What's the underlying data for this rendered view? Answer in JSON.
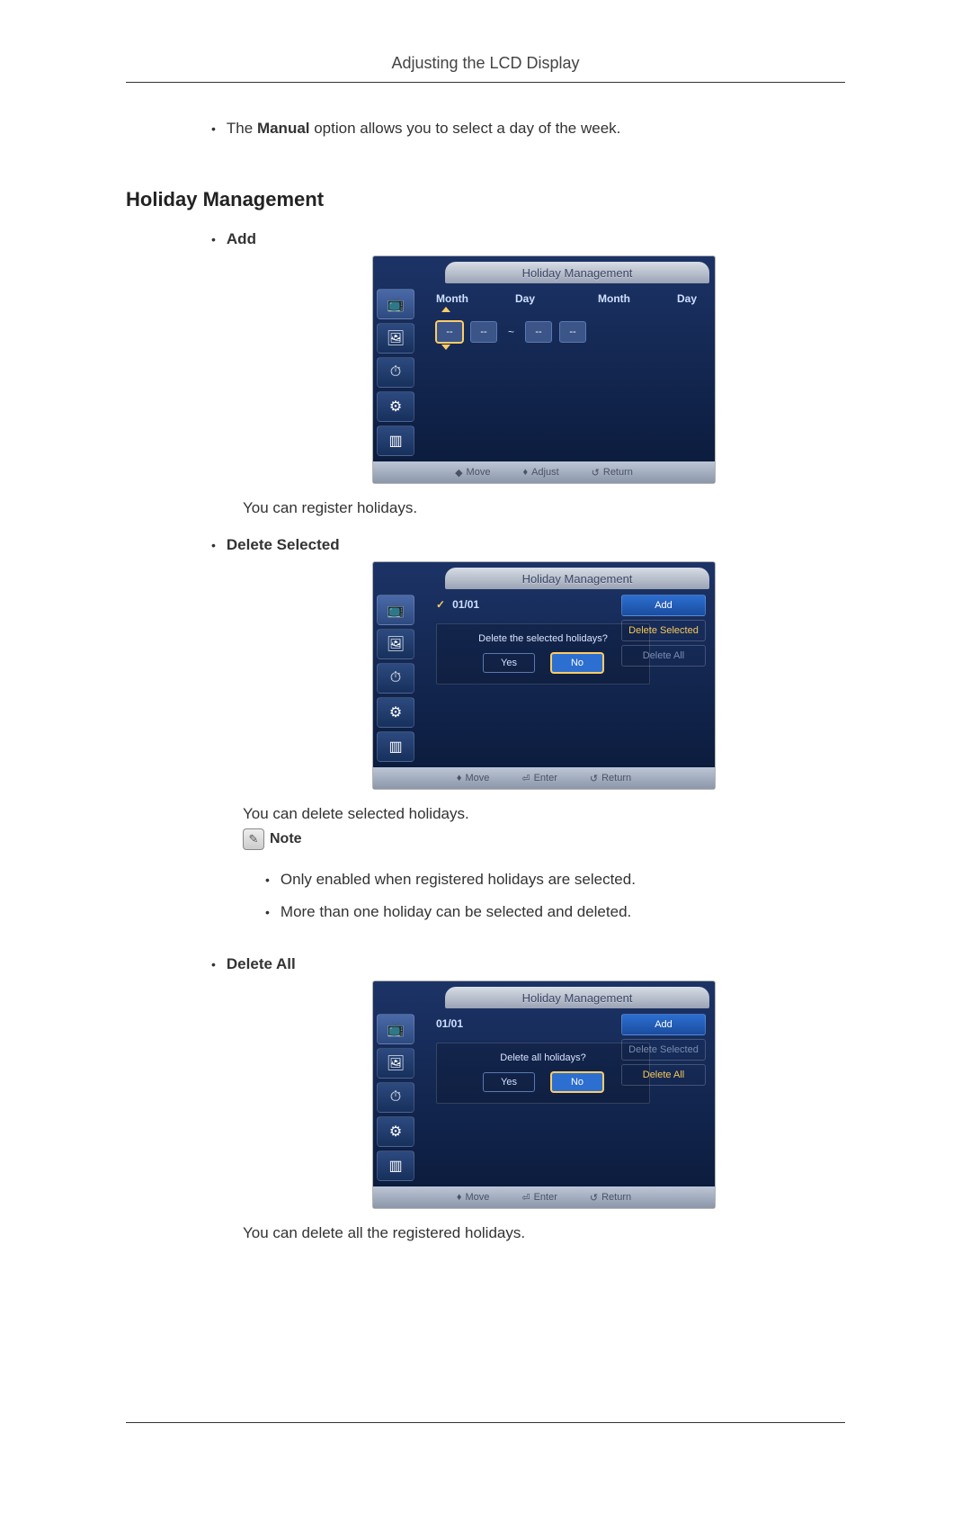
{
  "header": {
    "title": "Adjusting the LCD Display"
  },
  "intro": {
    "prefix": "The ",
    "bold": "Manual",
    "suffix": " option allows you to select a day of the week."
  },
  "section_heading": "Holiday Management",
  "add": {
    "label": "Add",
    "desc": "You can register holidays.",
    "osd": {
      "title": "Holiday Management",
      "labels": {
        "month": "Month",
        "day": "Day"
      },
      "values": {
        "m1": "--",
        "d1": "--",
        "m2": "--",
        "d2": "--",
        "sep": "~"
      },
      "footer": {
        "move": "Move",
        "adjust": "Adjust",
        "return": "Return"
      }
    }
  },
  "del_sel": {
    "label": "Delete Selected",
    "desc": "You can delete selected holidays.",
    "note_label": "Note",
    "notes": [
      "Only enabled when registered holidays are selected.",
      "More than one holiday can be selected and deleted."
    ],
    "osd": {
      "title": "Holiday Management",
      "entry": "01/01",
      "buttons": {
        "add": "Add",
        "del_sel": "Delete Selected",
        "del_all": "Delete All"
      },
      "dialog": {
        "q": "Delete the selected holidays?",
        "yes": "Yes",
        "no": "No"
      },
      "footer": {
        "move": "Move",
        "enter": "Enter",
        "return": "Return"
      }
    }
  },
  "del_all": {
    "label": "Delete All",
    "desc": "You can delete all the registered holidays.",
    "osd": {
      "title": "Holiday Management",
      "entry": "01/01",
      "buttons": {
        "add": "Add",
        "del_sel": "Delete Selected",
        "del_all": "Delete All"
      },
      "dialog": {
        "q": "Delete all holidays?",
        "yes": "Yes",
        "no": "No"
      },
      "footer": {
        "move": "Move",
        "enter": "Enter",
        "return": "Return"
      }
    }
  }
}
